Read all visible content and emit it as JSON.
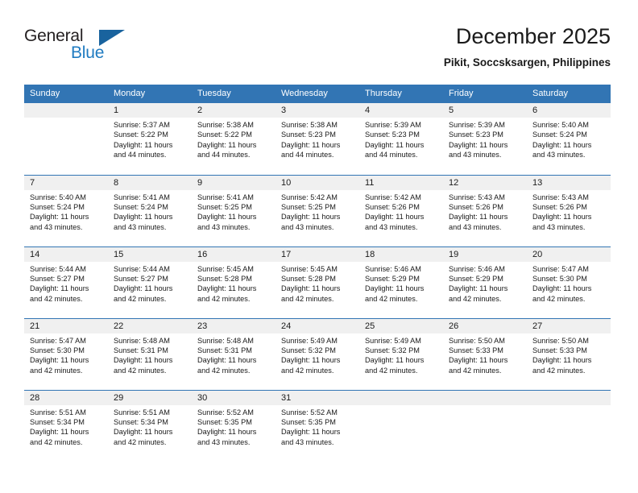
{
  "brand": {
    "name_top": "General",
    "name_bottom": "Blue",
    "triangle_color": "#19639e",
    "blue_color": "#1f7bc1"
  },
  "header": {
    "title": "December 2025",
    "subtitle": "Pikit, Soccsksargen, Philippines"
  },
  "theme": {
    "header_bg": "#3275b4",
    "daynum_bg": "#f0f0f0",
    "text": "#1a1a1a"
  },
  "calendar": {
    "weekday_headers": [
      "Sunday",
      "Monday",
      "Tuesday",
      "Wednesday",
      "Thursday",
      "Friday",
      "Saturday"
    ],
    "labels": {
      "sunrise": "Sunrise:",
      "sunset": "Sunset:",
      "daylight": "Daylight:"
    },
    "weeks": [
      [
        {
          "day": "",
          "sunrise": "",
          "sunset": "",
          "daylight_1": "",
          "daylight_2": ""
        },
        {
          "day": "1",
          "sunrise": "Sunrise: 5:37 AM",
          "sunset": "Sunset: 5:22 PM",
          "daylight_1": "Daylight: 11 hours",
          "daylight_2": "and 44 minutes."
        },
        {
          "day": "2",
          "sunrise": "Sunrise: 5:38 AM",
          "sunset": "Sunset: 5:22 PM",
          "daylight_1": "Daylight: 11 hours",
          "daylight_2": "and 44 minutes."
        },
        {
          "day": "3",
          "sunrise": "Sunrise: 5:38 AM",
          "sunset": "Sunset: 5:23 PM",
          "daylight_1": "Daylight: 11 hours",
          "daylight_2": "and 44 minutes."
        },
        {
          "day": "4",
          "sunrise": "Sunrise: 5:39 AM",
          "sunset": "Sunset: 5:23 PM",
          "daylight_1": "Daylight: 11 hours",
          "daylight_2": "and 44 minutes."
        },
        {
          "day": "5",
          "sunrise": "Sunrise: 5:39 AM",
          "sunset": "Sunset: 5:23 PM",
          "daylight_1": "Daylight: 11 hours",
          "daylight_2": "and 43 minutes."
        },
        {
          "day": "6",
          "sunrise": "Sunrise: 5:40 AM",
          "sunset": "Sunset: 5:24 PM",
          "daylight_1": "Daylight: 11 hours",
          "daylight_2": "and 43 minutes."
        }
      ],
      [
        {
          "day": "7",
          "sunrise": "Sunrise: 5:40 AM",
          "sunset": "Sunset: 5:24 PM",
          "daylight_1": "Daylight: 11 hours",
          "daylight_2": "and 43 minutes."
        },
        {
          "day": "8",
          "sunrise": "Sunrise: 5:41 AM",
          "sunset": "Sunset: 5:24 PM",
          "daylight_1": "Daylight: 11 hours",
          "daylight_2": "and 43 minutes."
        },
        {
          "day": "9",
          "sunrise": "Sunrise: 5:41 AM",
          "sunset": "Sunset: 5:25 PM",
          "daylight_1": "Daylight: 11 hours",
          "daylight_2": "and 43 minutes."
        },
        {
          "day": "10",
          "sunrise": "Sunrise: 5:42 AM",
          "sunset": "Sunset: 5:25 PM",
          "daylight_1": "Daylight: 11 hours",
          "daylight_2": "and 43 minutes."
        },
        {
          "day": "11",
          "sunrise": "Sunrise: 5:42 AM",
          "sunset": "Sunset: 5:26 PM",
          "daylight_1": "Daylight: 11 hours",
          "daylight_2": "and 43 minutes."
        },
        {
          "day": "12",
          "sunrise": "Sunrise: 5:43 AM",
          "sunset": "Sunset: 5:26 PM",
          "daylight_1": "Daylight: 11 hours",
          "daylight_2": "and 43 minutes."
        },
        {
          "day": "13",
          "sunrise": "Sunrise: 5:43 AM",
          "sunset": "Sunset: 5:26 PM",
          "daylight_1": "Daylight: 11 hours",
          "daylight_2": "and 43 minutes."
        }
      ],
      [
        {
          "day": "14",
          "sunrise": "Sunrise: 5:44 AM",
          "sunset": "Sunset: 5:27 PM",
          "daylight_1": "Daylight: 11 hours",
          "daylight_2": "and 42 minutes."
        },
        {
          "day": "15",
          "sunrise": "Sunrise: 5:44 AM",
          "sunset": "Sunset: 5:27 PM",
          "daylight_1": "Daylight: 11 hours",
          "daylight_2": "and 42 minutes."
        },
        {
          "day": "16",
          "sunrise": "Sunrise: 5:45 AM",
          "sunset": "Sunset: 5:28 PM",
          "daylight_1": "Daylight: 11 hours",
          "daylight_2": "and 42 minutes."
        },
        {
          "day": "17",
          "sunrise": "Sunrise: 5:45 AM",
          "sunset": "Sunset: 5:28 PM",
          "daylight_1": "Daylight: 11 hours",
          "daylight_2": "and 42 minutes."
        },
        {
          "day": "18",
          "sunrise": "Sunrise: 5:46 AM",
          "sunset": "Sunset: 5:29 PM",
          "daylight_1": "Daylight: 11 hours",
          "daylight_2": "and 42 minutes."
        },
        {
          "day": "19",
          "sunrise": "Sunrise: 5:46 AM",
          "sunset": "Sunset: 5:29 PM",
          "daylight_1": "Daylight: 11 hours",
          "daylight_2": "and 42 minutes."
        },
        {
          "day": "20",
          "sunrise": "Sunrise: 5:47 AM",
          "sunset": "Sunset: 5:30 PM",
          "daylight_1": "Daylight: 11 hours",
          "daylight_2": "and 42 minutes."
        }
      ],
      [
        {
          "day": "21",
          "sunrise": "Sunrise: 5:47 AM",
          "sunset": "Sunset: 5:30 PM",
          "daylight_1": "Daylight: 11 hours",
          "daylight_2": "and 42 minutes."
        },
        {
          "day": "22",
          "sunrise": "Sunrise: 5:48 AM",
          "sunset": "Sunset: 5:31 PM",
          "daylight_1": "Daylight: 11 hours",
          "daylight_2": "and 42 minutes."
        },
        {
          "day": "23",
          "sunrise": "Sunrise: 5:48 AM",
          "sunset": "Sunset: 5:31 PM",
          "daylight_1": "Daylight: 11 hours",
          "daylight_2": "and 42 minutes."
        },
        {
          "day": "24",
          "sunrise": "Sunrise: 5:49 AM",
          "sunset": "Sunset: 5:32 PM",
          "daylight_1": "Daylight: 11 hours",
          "daylight_2": "and 42 minutes."
        },
        {
          "day": "25",
          "sunrise": "Sunrise: 5:49 AM",
          "sunset": "Sunset: 5:32 PM",
          "daylight_1": "Daylight: 11 hours",
          "daylight_2": "and 42 minutes."
        },
        {
          "day": "26",
          "sunrise": "Sunrise: 5:50 AM",
          "sunset": "Sunset: 5:33 PM",
          "daylight_1": "Daylight: 11 hours",
          "daylight_2": "and 42 minutes."
        },
        {
          "day": "27",
          "sunrise": "Sunrise: 5:50 AM",
          "sunset": "Sunset: 5:33 PM",
          "daylight_1": "Daylight: 11 hours",
          "daylight_2": "and 42 minutes."
        }
      ],
      [
        {
          "day": "28",
          "sunrise": "Sunrise: 5:51 AM",
          "sunset": "Sunset: 5:34 PM",
          "daylight_1": "Daylight: 11 hours",
          "daylight_2": "and 42 minutes."
        },
        {
          "day": "29",
          "sunrise": "Sunrise: 5:51 AM",
          "sunset": "Sunset: 5:34 PM",
          "daylight_1": "Daylight: 11 hours",
          "daylight_2": "and 42 minutes."
        },
        {
          "day": "30",
          "sunrise": "Sunrise: 5:52 AM",
          "sunset": "Sunset: 5:35 PM",
          "daylight_1": "Daylight: 11 hours",
          "daylight_2": "and 43 minutes."
        },
        {
          "day": "31",
          "sunrise": "Sunrise: 5:52 AM",
          "sunset": "Sunset: 5:35 PM",
          "daylight_1": "Daylight: 11 hours",
          "daylight_2": "and 43 minutes."
        },
        {
          "day": "",
          "sunrise": "",
          "sunset": "",
          "daylight_1": "",
          "daylight_2": ""
        },
        {
          "day": "",
          "sunrise": "",
          "sunset": "",
          "daylight_1": "",
          "daylight_2": ""
        },
        {
          "day": "",
          "sunrise": "",
          "sunset": "",
          "daylight_1": "",
          "daylight_2": ""
        }
      ]
    ]
  }
}
